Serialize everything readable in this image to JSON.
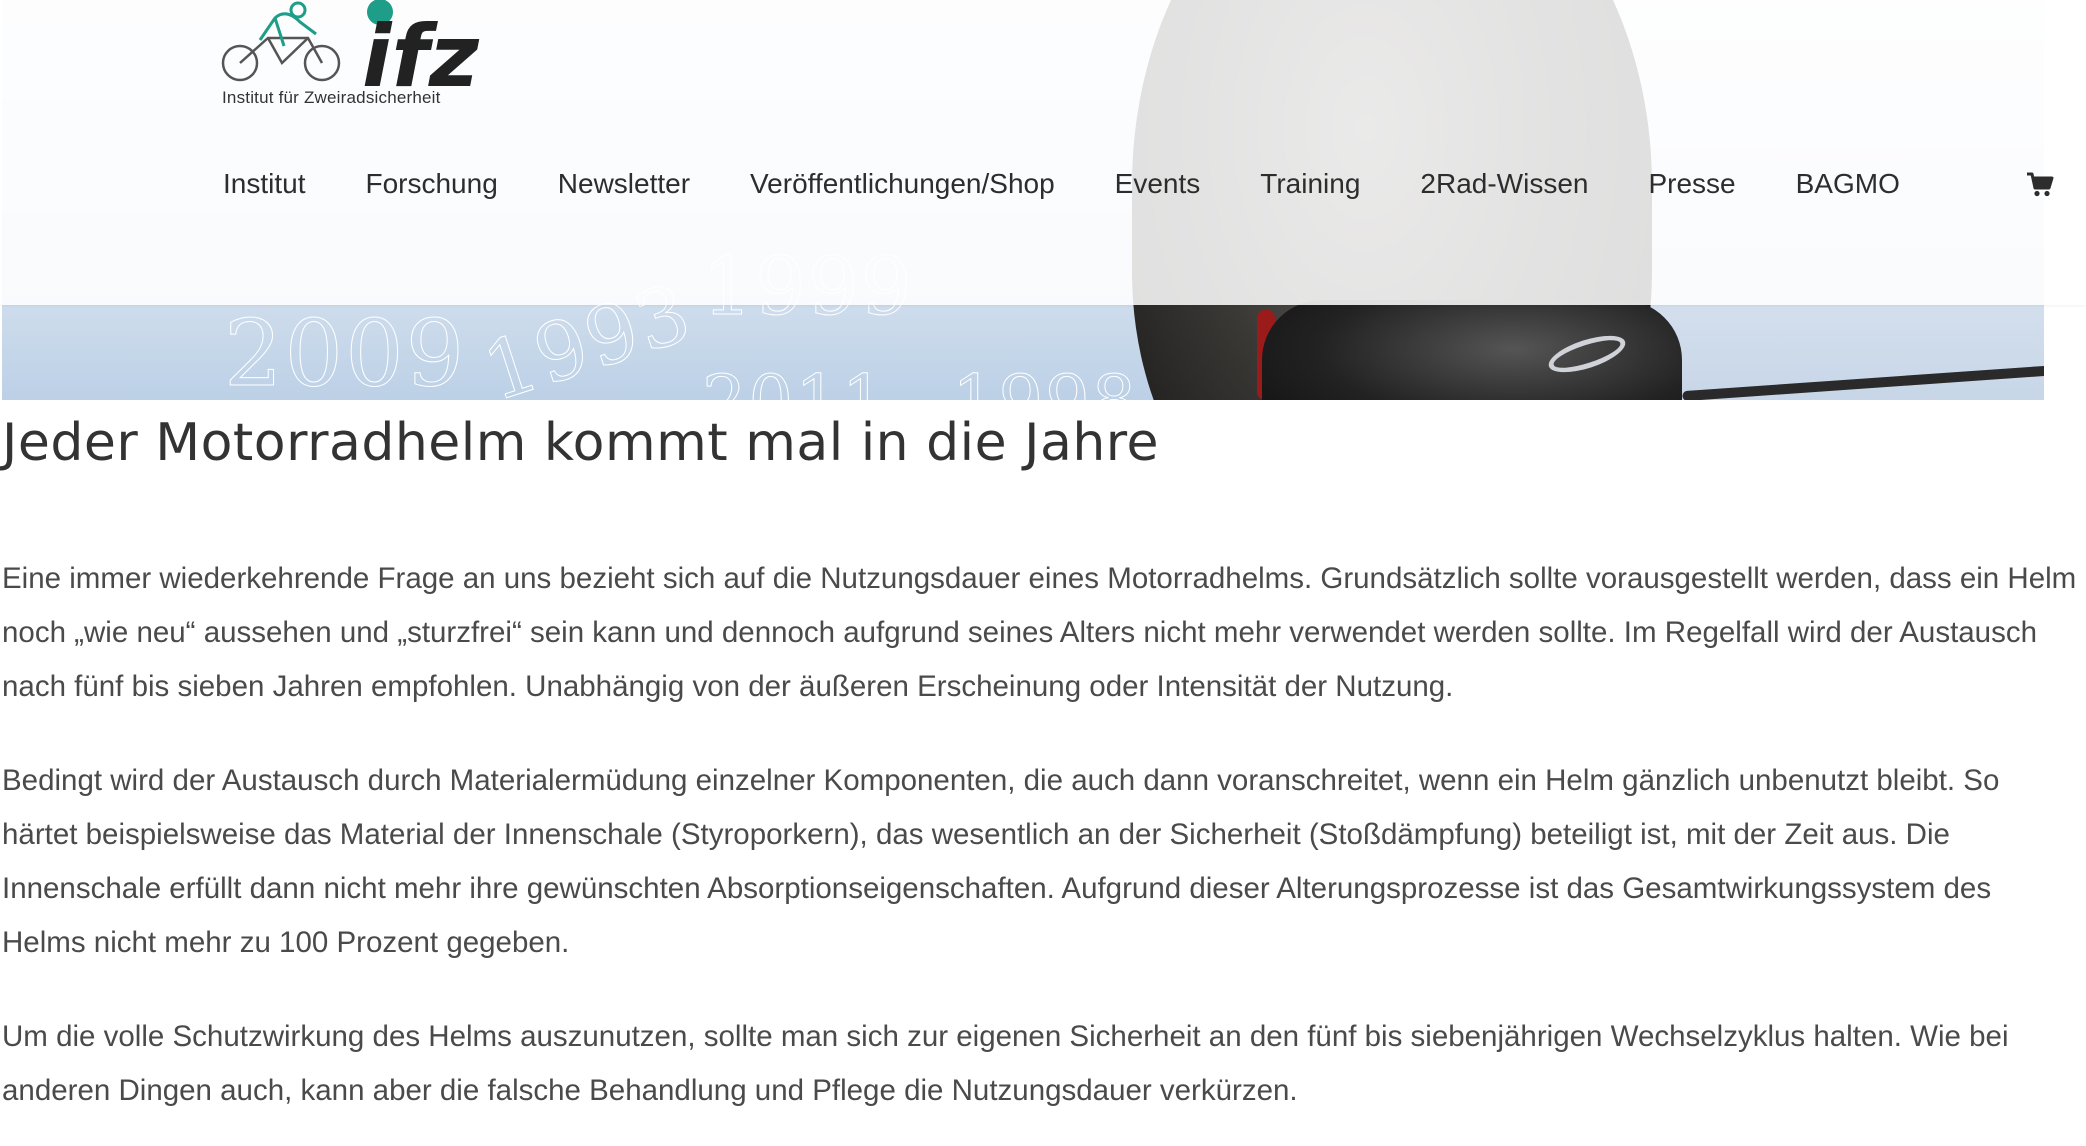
{
  "brand": {
    "name": "ifz",
    "tagline": "Institut für Zweiradsicherheit",
    "colors": {
      "teal": "#1e9e88",
      "dark": "#222222"
    }
  },
  "nav": {
    "items": [
      {
        "label": "Institut"
      },
      {
        "label": "Forschung"
      },
      {
        "label": "Newsletter"
      },
      {
        "label": "Veröffentlichungen/Shop"
      },
      {
        "label": "Events"
      },
      {
        "label": "Training"
      },
      {
        "label": "2Rad-Wissen"
      },
      {
        "label": "Presse"
      },
      {
        "label": "BAGMO"
      }
    ],
    "cart_icon": "shopping-cart-icon"
  },
  "hero": {
    "sky_years": [
      "2009",
      "1993",
      "1999",
      "2011",
      "1998"
    ]
  },
  "article": {
    "title": "Jeder Motorradhelm kommt mal in die Jahre",
    "paragraphs": [
      "Eine immer wiederkehrende Frage an uns bezieht sich auf die Nutzungsdauer eines Motorradhelms. Grundsätzlich sollte vorausgestellt werden, dass ein Helm noch „wie neu“ aussehen und „sturzfrei“ sein kann und dennoch aufgrund seines Alters nicht mehr verwendet werden sollte. Im Regelfall wird der Austausch nach fünf bis sieben Jahren empfohlen. Unabhängig von der äußeren Erscheinung oder Intensität der Nutzung.",
      "Bedingt wird der Austausch durch Materialermüdung einzelner Komponenten, die auch dann voranschreitet, wenn ein Helm gänzlich unbenutzt bleibt. So härtet beispielsweise das Material der Innenschale (Styroporkern), das wesentlich an der Sicherheit (Stoßdämpfung) beteiligt ist, mit der Zeit aus. Die Innenschale erfüllt dann nicht mehr ihre gewünschten Absorptionseigenschaften. Aufgrund dieser Alterungsprozesse ist das Gesamtwirkungssystem des Helms nicht mehr zu 100 Prozent gegeben.",
      "Um die volle Schutzwirkung des Helms auszunutzen, sollte man sich zur eigenen Sicherheit an den fünf bis siebenjährigen Wechselzyklus halten. Wie bei anderen Dingen auch, kann aber die falsche Behandlung und Pflege die Nutzungsdauer verkürzen."
    ]
  }
}
